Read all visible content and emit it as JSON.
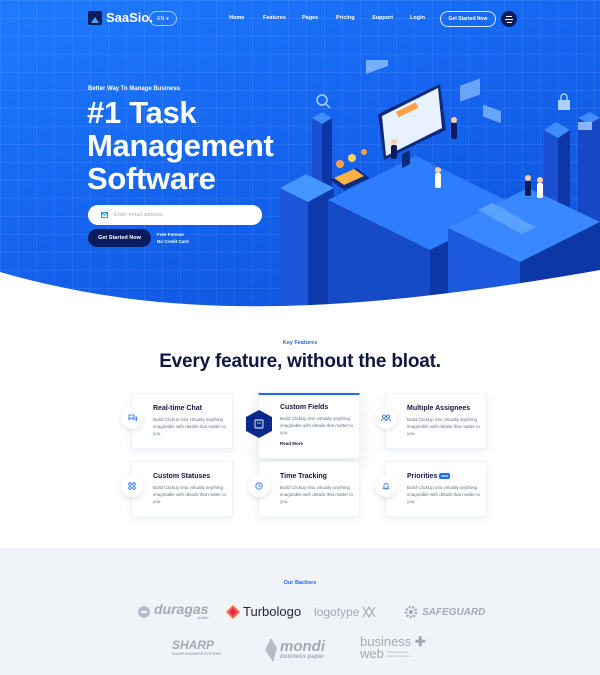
{
  "brand": {
    "name": "SaaSio."
  },
  "nav": {
    "language": "EN",
    "links": [
      "Home",
      "Features",
      "Pages",
      "Pricing",
      "Support",
      "Login"
    ],
    "cta": "Get Started Now"
  },
  "hero": {
    "tagline": "Better Way To Manage Business",
    "title_lines": [
      "#1 Task",
      "Management",
      "Software"
    ],
    "email_placeholder": "Enter email address",
    "cta": "Get Started Now",
    "note_1": "Free Forever",
    "note_2": "No Credit Card"
  },
  "features": {
    "label": "Key Features",
    "title": "Every feature, without the bloat.",
    "desc": "Build ClickUp into virtually anything imaginable with details that matter to you.",
    "read_more": "Read More",
    "new_badge": "NEW",
    "items": [
      {
        "title": "Real-time Chat",
        "icon": "chat-icon"
      },
      {
        "title": "Custom Fields",
        "icon": "fields-icon"
      },
      {
        "title": "Multiple Assignees",
        "icon": "assignees-icon"
      },
      {
        "title": "Custom Statuses",
        "icon": "statuses-icon"
      },
      {
        "title": "Time Tracking",
        "icon": "clock-icon"
      },
      {
        "title": "Priorities",
        "icon": "bell-icon"
      }
    ]
  },
  "backers": {
    "label": "Our Backers",
    "logos": [
      "duragas",
      "Turbologo",
      "logotype",
      "SAFEGUARD",
      "SHARP",
      "mondi",
      "business web"
    ],
    "sub": {
      "duragas": "bottle",
      "sharp": "SHARP BUSINESS SYSTEMS",
      "mondi": "business paper",
      "business_web_line1": "business",
      "business_web_line2": "web",
      "business_web_tag": "Comprehensive Data for Projects"
    }
  },
  "colors": {
    "primary": "#1b6cf2",
    "navy": "#0a1c5c",
    "backers_bg": "#f0f4f9"
  }
}
